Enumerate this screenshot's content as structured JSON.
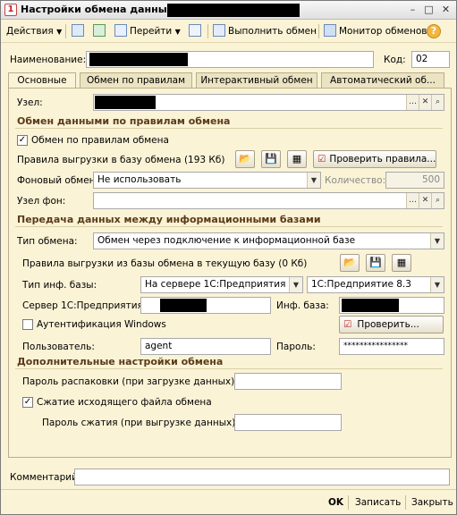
{
  "window": {
    "title": "Настройки обмена данными"
  },
  "toolbar": {
    "actions": "Действия",
    "goto": "Перейти",
    "run_exchange": "Выполнить обмен",
    "monitor": "Монитор обменов",
    "help": "?"
  },
  "header": {
    "name_label": "Наименование:",
    "code_label": "Код:",
    "code_value": "02"
  },
  "tabs": [
    "Основные",
    "Обмен по правилам",
    "Интерактивный обмен",
    "Автоматический об..."
  ],
  "main": {
    "node_label": "Узел:",
    "section1": "Обмен данными по правилам обмена",
    "rules_checkbox": "Обмен по правилам обмена",
    "rules_upload_label": "Правила выгрузки в базу обмена (193 Кб)",
    "check_rules_button": "Проверить правила...",
    "background_label": "Фоновый обмен:",
    "background_value": "Не использовать",
    "quantity_label": "Количество:",
    "quantity_value": "500",
    "bg_node_label": "Узел фон:",
    "section2": "Передача данных между информационными базами",
    "exchange_type_label": "Тип обмена:",
    "exchange_type_value": "Обмен через подключение к информационной базе",
    "rules_from_label": "Правила выгрузки из базы обмена в текущую базу (0 Кб)",
    "ib_type_label": "Тип инф. базы:",
    "ib_type_value": "На сервере 1С:Предприятия",
    "platform_value": "1С:Предприятие 8.3",
    "server_label": "Сервер 1С:Предприятия:",
    "ib_label": "Инф. база:",
    "windows_auth": "Аутентификация Windows",
    "check_button": "Проверить...",
    "user_label": "Пользователь:",
    "user_value": "agent",
    "password_label": "Пароль:",
    "password_value": "****************",
    "section3": "Дополнительные настройки обмена",
    "unpack_password_label": "Пароль распаковки (при загрузке данных):",
    "compress_checkbox": "Сжатие исходящего файла обмена",
    "compress_password_label": "Пароль сжатия (при выгрузке данных):"
  },
  "footer": {
    "comment_label": "Комментарий:",
    "ok": "OK",
    "save": "Записать",
    "close": "Закрыть"
  }
}
